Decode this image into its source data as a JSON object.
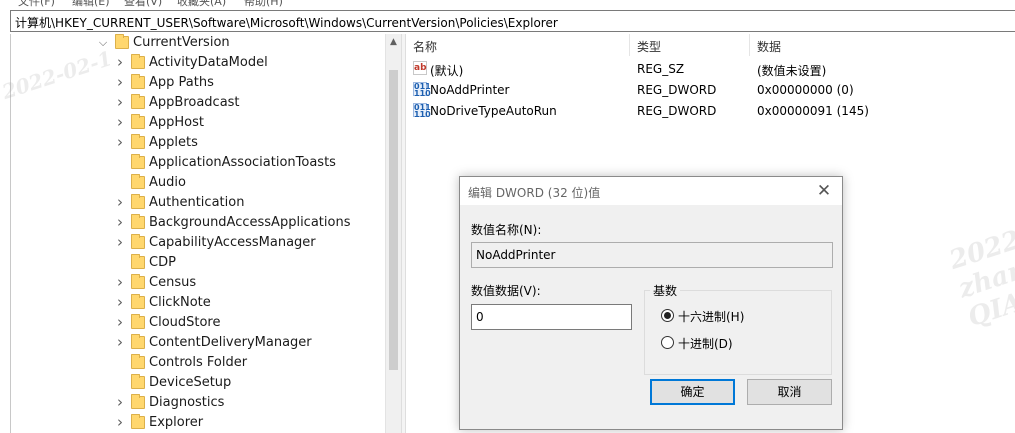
{
  "menu": [
    "文件(F)",
    "编辑(E)",
    "查看(V)",
    "收藏夹(A)",
    "帮助(H)"
  ],
  "address": "计算机\\HKEY_CURRENT_USER\\Software\\Microsoft\\Windows\\CurrentVersion\\Policies\\Explorer",
  "tree": {
    "parent": "CurrentVersion",
    "children": [
      {
        "label": "ActivityDataModel",
        "expandable": true
      },
      {
        "label": "App Paths",
        "expandable": true
      },
      {
        "label": "AppBroadcast",
        "expandable": true
      },
      {
        "label": "AppHost",
        "expandable": true
      },
      {
        "label": "Applets",
        "expandable": true
      },
      {
        "label": "ApplicationAssociationToasts",
        "expandable": false
      },
      {
        "label": "Audio",
        "expandable": false
      },
      {
        "label": "Authentication",
        "expandable": true
      },
      {
        "label": "BackgroundAccessApplications",
        "expandable": true
      },
      {
        "label": "CapabilityAccessManager",
        "expandable": true
      },
      {
        "label": "CDP",
        "expandable": false
      },
      {
        "label": "Census",
        "expandable": true
      },
      {
        "label": "ClickNote",
        "expandable": true
      },
      {
        "label": "CloudStore",
        "expandable": true
      },
      {
        "label": "ContentDeliveryManager",
        "expandable": true
      },
      {
        "label": "Controls Folder",
        "expandable": false
      },
      {
        "label": "DeviceSetup",
        "expandable": false
      },
      {
        "label": "Diagnostics",
        "expandable": true
      },
      {
        "label": "Explorer",
        "expandable": true
      }
    ]
  },
  "list": {
    "headers": {
      "name": "名称",
      "type": "类型",
      "data": "数据"
    },
    "rows": [
      {
        "icon": "string-value-icon",
        "icon_text": "ab",
        "name": "(默认)",
        "type": "REG_SZ",
        "data": "(数值未设置)"
      },
      {
        "icon": "binary-value-icon",
        "icon_text": "011\n110",
        "name": "NoAddPrinter",
        "type": "REG_DWORD",
        "data": "0x00000000 (0)"
      },
      {
        "icon": "binary-value-icon",
        "icon_text": "011\n110",
        "name": "NoDriveTypeAutoRun",
        "type": "REG_DWORD",
        "data": "0x00000091 (145)"
      }
    ]
  },
  "dialog": {
    "title": "编辑 DWORD (32 位)值",
    "name_label": "数值名称(N):",
    "name_value": "NoAddPrinter",
    "data_label": "数值数据(V):",
    "data_value": "0",
    "base_label": "基数",
    "hex_label": "十六进制(H)",
    "dec_label": "十进制(D)",
    "selected_base": "hex",
    "ok": "确定",
    "cancel": "取消"
  },
  "watermark": {
    "date": "2022-02-1",
    "user": "zhangxianbin",
    "org": "QIANXIN"
  },
  "colors": {
    "accent": "#0078d7",
    "folder": "#ffd76e"
  }
}
